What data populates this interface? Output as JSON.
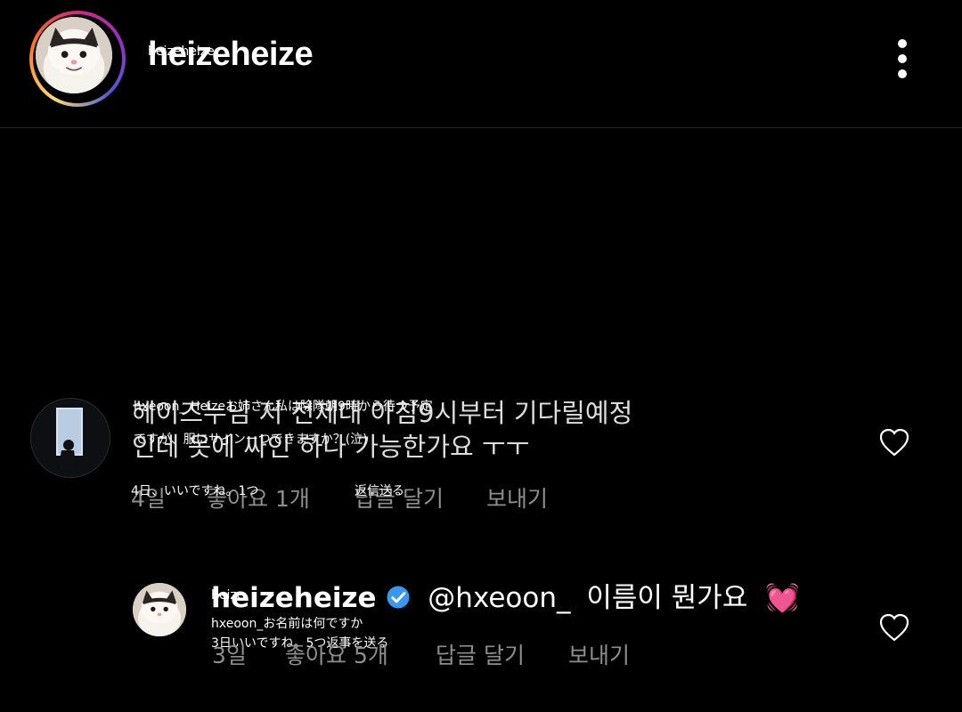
{
  "header": {
    "username": "heizeheize",
    "overlay_label": "heizeheize",
    "more_icon": "more-vertical-icon"
  },
  "comment": {
    "author_overlay": "hxeoon_",
    "text_overlay_line1": "Heizeお姉さん私は除隊朝9時から待つ予定",
    "text_overlay_line2": "ですが、服にサインーつできますか？(泣)",
    "text_line1": "헤이즈누님 저 전제대 아침9시부터 기다릴예정",
    "text_line2": "인데 옷에 싸인 하나 가능한가요 ㅜㅜ",
    "meta_overlay": "4日、いいですね。1つ",
    "reply_overlay": "返信送る",
    "time": "4일",
    "likes": "좋아요 1개",
    "reply_label": "답글 달기",
    "send_label": "보내기"
  },
  "reply": {
    "author": "heizeheize",
    "author_overlay": "heize",
    "mention": "@hxeoon_",
    "text": "이름이 뭔가요",
    "overlay_line1": "hxeoon_お名前は何ですか",
    "overlay_line2": "3日いいですね。5つ返事を送る",
    "time": "3일",
    "likes": "좋아요 5개",
    "reply_label": "답글 달기",
    "send_label": "보내기",
    "emoji": "💓"
  },
  "colors": {
    "background": "#000000",
    "text": "#ffffff",
    "meta": "#8e8e8e",
    "verified": "#3897f0"
  }
}
